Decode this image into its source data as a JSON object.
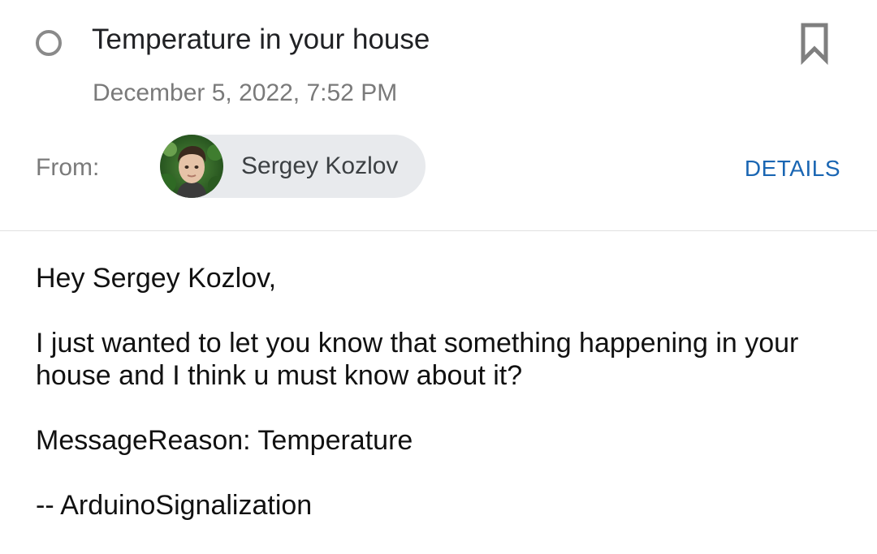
{
  "message": {
    "subject": "Temperature in your house",
    "date": "December 5, 2022, 7:52 PM",
    "from_label": "From:",
    "sender_name": "Sergey Kozlov",
    "details_label": "DETAILS"
  },
  "body": {
    "greeting": "Hey Sergey Kozlov,",
    "paragraph": "I just wanted to let you know that something happening in your\nhouse and I think u must know about it?",
    "reason": "MessageReason: Temperature",
    "signature": "-- ArduinoSignalization"
  },
  "icons": {
    "read_toggle": "circle-outline-icon",
    "bookmark": "bookmark-icon",
    "avatar": "avatar-photo"
  },
  "colors": {
    "link": "#1a66b3",
    "chip_background": "#e8eaed",
    "muted_text": "#7a7a7a"
  }
}
